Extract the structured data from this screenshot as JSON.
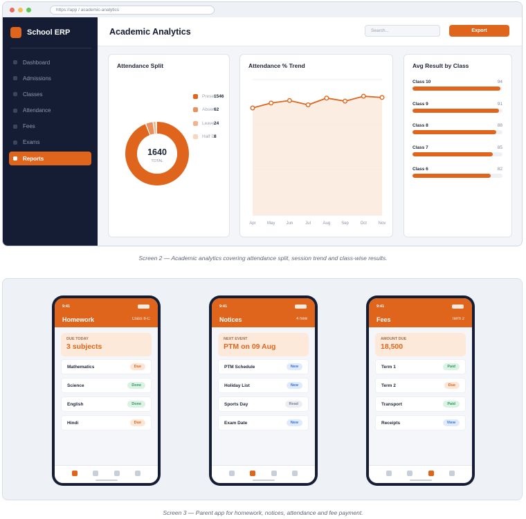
{
  "browser": {
    "url": "https://app  /  academic-analytics"
  },
  "sidebar": {
    "brand": "School ERP",
    "items": [
      {
        "label": "Dashboard",
        "active": false
      },
      {
        "label": "Admissions",
        "active": false
      },
      {
        "label": "Classes",
        "active": false
      },
      {
        "label": "Attendance",
        "active": false
      },
      {
        "label": "Fees",
        "active": false
      },
      {
        "label": "Exams",
        "active": false
      },
      {
        "label": "Reports",
        "active": true
      }
    ]
  },
  "header": {
    "title": "Academic Analytics",
    "search_placeholder": "Search...",
    "export_label": "Export"
  },
  "attendance_split": {
    "title": "Attendance Split",
    "total": "1640",
    "total_label": "TOTAL",
    "legend": [
      {
        "label": "Present",
        "value": "1546",
        "color": "#e0651c"
      },
      {
        "label": "Absent",
        "value": "62",
        "color": "#e8915c"
      },
      {
        "label": "Leave",
        "value": "24",
        "color": "#f0b48e"
      },
      {
        "label": "Half Day",
        "value": "8",
        "color": "#f7d6bd"
      }
    ]
  },
  "attendance_trend": {
    "title": "Attendance % Trend"
  },
  "avg_result": {
    "title": "Avg Result by Class",
    "rows": [
      {
        "label": "Class 10",
        "value": "94",
        "fraction": 0.98
      },
      {
        "label": "Class 9",
        "value": "91",
        "fraction": 0.96
      },
      {
        "label": "Class 8",
        "value": "88",
        "fraction": 0.93
      },
      {
        "label": "Class 7",
        "value": "85",
        "fraction": 0.89
      },
      {
        "label": "Class 6",
        "value": "82",
        "fraction": 0.87
      }
    ]
  },
  "chart_data": [
    {
      "type": "pie",
      "title": "Attendance Split",
      "categories": [
        "Present",
        "Absent",
        "Leave",
        "Half Day"
      ],
      "values": [
        1546,
        62,
        24,
        8
      ],
      "total": 1640
    },
    {
      "type": "area",
      "title": "Attendance % Trend",
      "categories": [
        "Apr",
        "May",
        "Jun",
        "Jul",
        "Aug",
        "Sep",
        "Oct",
        "Nov"
      ],
      "values": [
        92.4,
        93.2,
        93.6,
        92.9,
        94.0,
        93.5,
        94.3,
        94.1
      ],
      "ylim": [
        75,
        97
      ],
      "grid": true
    },
    {
      "type": "bar",
      "title": "Avg Result by Class",
      "categories": [
        "Class 10",
        "Class 9",
        "Class 8",
        "Class 7",
        "Class 6"
      ],
      "values": [
        94,
        91,
        88,
        85,
        82
      ]
    }
  ],
  "captions": {
    "screen2": "Screen 2 — Academic analytics covering attendance split, session trend and class-wise results.",
    "screen3": "Screen 3 — Parent app for homework, notices, attendance and fee payment."
  },
  "phones": [
    {
      "time": "9:41",
      "title": "Homework",
      "subtitle": "Class 8-C",
      "hero_label": "DUE TODAY",
      "hero_value": "3 subjects",
      "rows": [
        {
          "label": "Mathematics",
          "status": "Due",
          "kind": "due"
        },
        {
          "label": "Science",
          "status": "Done",
          "kind": "done"
        },
        {
          "label": "English",
          "status": "Done",
          "kind": "done"
        },
        {
          "label": "Hindi",
          "status": "Due",
          "kind": "due"
        }
      ],
      "active_tab": 0
    },
    {
      "time": "9:41",
      "title": "Notices",
      "subtitle": "4 new",
      "hero_label": "NEXT EVENT",
      "hero_value": "PTM on 09 Aug",
      "rows": [
        {
          "label": "PTM Schedule",
          "status": "New",
          "kind": "new"
        },
        {
          "label": "Holiday List",
          "status": "New",
          "kind": "new"
        },
        {
          "label": "Sports Day",
          "status": "Read",
          "kind": "read"
        },
        {
          "label": "Exam Date",
          "status": "New",
          "kind": "new"
        }
      ],
      "active_tab": 1
    },
    {
      "time": "9:41",
      "title": "Fees",
      "subtitle": "Term 2",
      "hero_label": "AMOUNT DUE",
      "hero_value": "18,500",
      "rows": [
        {
          "label": "Term 1",
          "status": "Paid",
          "kind": "paid"
        },
        {
          "label": "Term 2",
          "status": "Due",
          "kind": "due"
        },
        {
          "label": "Transport",
          "status": "Paid",
          "kind": "paid"
        },
        {
          "label": "Receipts",
          "status": "View",
          "kind": "view"
        }
      ],
      "active_tab": 2
    }
  ]
}
